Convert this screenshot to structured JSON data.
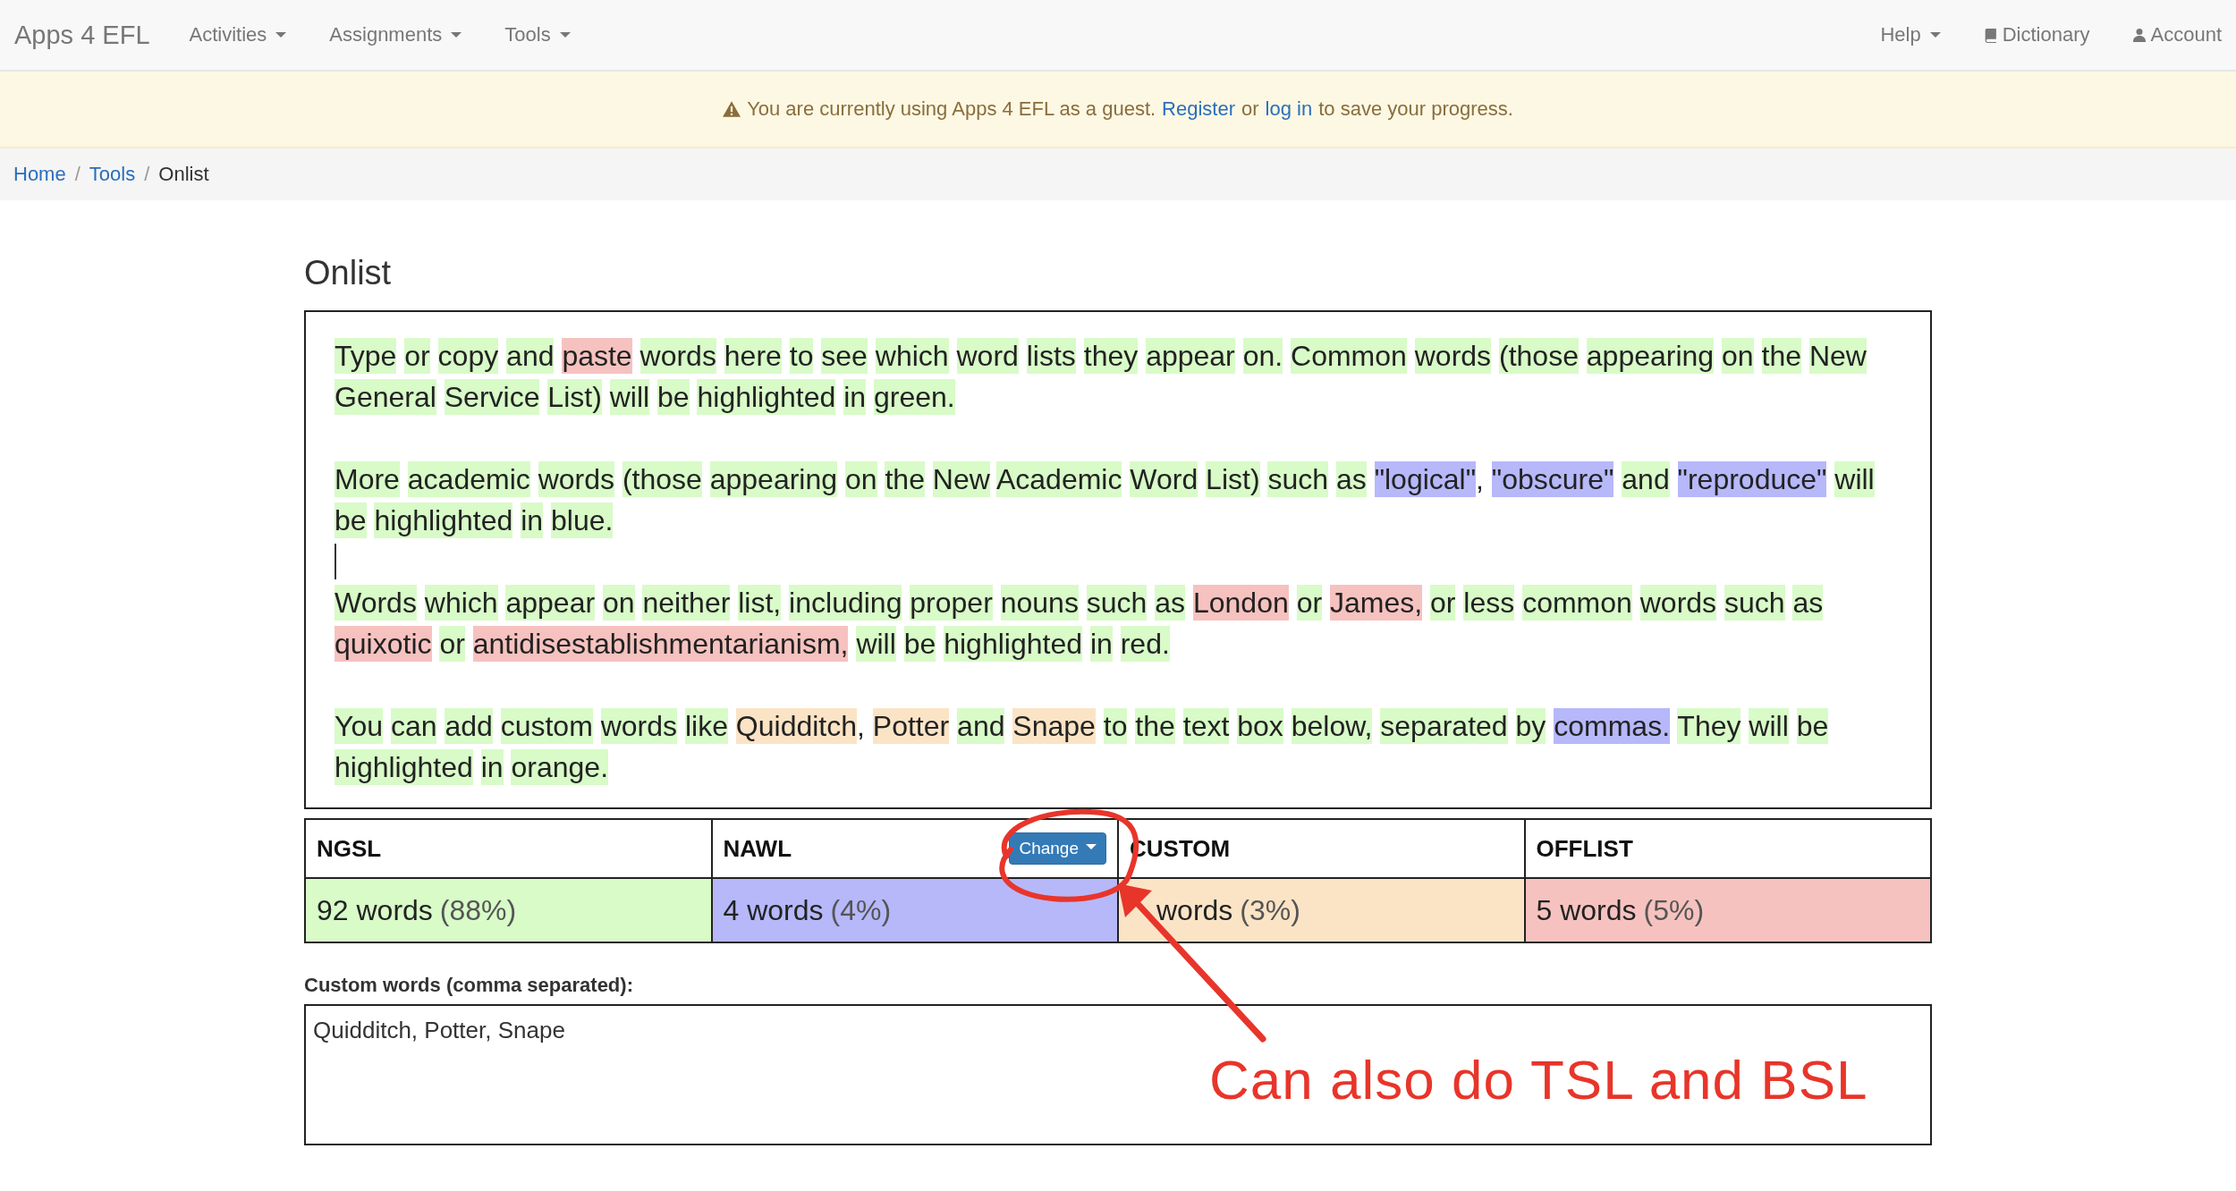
{
  "navbar": {
    "brand": "Apps 4 EFL",
    "left_menus": [
      {
        "label": "Activities"
      },
      {
        "label": "Assignments"
      },
      {
        "label": "Tools"
      }
    ],
    "right_items": [
      {
        "label": "Help",
        "kind": "dropdown"
      },
      {
        "label": "Dictionary",
        "kind": "book"
      },
      {
        "label": "Account",
        "kind": "user"
      }
    ]
  },
  "alert": {
    "before": "You are currently using Apps 4 EFL as a guest.",
    "link1": "Register",
    "middle": "or",
    "link2": "log in",
    "after": "to save your progress."
  },
  "breadcrumb": {
    "separator": "/",
    "items": [
      {
        "label": "Home",
        "selected": false
      },
      {
        "label": "Tools",
        "selected": false
      },
      {
        "label": "Onlist",
        "selected": true
      }
    ]
  },
  "title": "Onlist",
  "editor": {
    "paragraphs": [
      {
        "words": [
          {
            "w": "Type",
            "kind": "ngsl"
          },
          {
            "w": "or",
            "kind": "ngsl"
          },
          {
            "w": "copy",
            "kind": "ngsl"
          },
          {
            "w": "and",
            "kind": "ngsl"
          },
          {
            "w": "paste",
            "kind": "offlist"
          },
          {
            "w": "words",
            "kind": "ngsl"
          },
          {
            "w": "here",
            "kind": "ngsl"
          },
          {
            "w": "to",
            "kind": "ngsl"
          },
          {
            "w": "see",
            "kind": "ngsl"
          },
          {
            "w": "which",
            "kind": "ngsl"
          },
          {
            "w": "word",
            "kind": "ngsl"
          },
          {
            "w": "lists",
            "kind": "ngsl"
          },
          {
            "w": "they",
            "kind": "ngsl"
          },
          {
            "w": "appear",
            "kind": "ngsl"
          },
          {
            "w": "on.",
            "kind": "ngsl"
          },
          {
            "w": "Common",
            "kind": "ngsl"
          },
          {
            "w": "words",
            "kind": "ngsl"
          },
          {
            "w": "(those",
            "kind": "ngsl"
          },
          {
            "w": "appearing",
            "kind": "ngsl"
          },
          {
            "w": "on",
            "kind": "ngsl"
          },
          {
            "w": "the",
            "kind": "ngsl"
          },
          {
            "w": "New",
            "kind": "ngsl"
          },
          {
            "w": "General",
            "kind": "ngsl"
          },
          {
            "w": "Service",
            "kind": "ngsl"
          },
          {
            "w": "List)",
            "kind": "ngsl"
          },
          {
            "w": "will",
            "kind": "ngsl"
          },
          {
            "w": "be",
            "kind": "ngsl"
          },
          {
            "w": "highlighted",
            "kind": "ngsl"
          },
          {
            "w": "in",
            "kind": "ngsl"
          },
          {
            "w": "green.",
            "kind": "ngsl"
          }
        ]
      },
      {
        "words": [
          {
            "w": "More",
            "kind": "ngsl"
          },
          {
            "w": "academic",
            "kind": "ngsl"
          },
          {
            "w": "words",
            "kind": "ngsl"
          },
          {
            "w": "(those",
            "kind": "ngsl"
          },
          {
            "w": "appearing",
            "kind": "ngsl"
          },
          {
            "w": "on",
            "kind": "ngsl"
          },
          {
            "w": "the",
            "kind": "ngsl"
          },
          {
            "w": "New",
            "kind": "ngsl"
          },
          {
            "w": "Academic",
            "kind": "ngsl"
          },
          {
            "w": "Word",
            "kind": "ngsl"
          },
          {
            "w": "List)",
            "kind": "ngsl"
          },
          {
            "w": "such",
            "kind": "ngsl"
          },
          {
            "w": "as",
            "kind": "ngsl"
          },
          {
            "w": "\"logical\"",
            "kind": "nawl"
          },
          {
            "w": ",",
            "kind": "punct"
          },
          {
            "w": "\"obscure\"",
            "kind": "nawl"
          },
          {
            "w": "and",
            "kind": "ngsl"
          },
          {
            "w": "\"reproduce\"",
            "kind": "nawl"
          },
          {
            "w": "will",
            "kind": "ngsl"
          },
          {
            "w": "be",
            "kind": "ngsl"
          },
          {
            "w": "highlighted",
            "kind": "ngsl"
          },
          {
            "w": "in",
            "kind": "ngsl"
          },
          {
            "w": "blue.",
            "kind": "ngsl"
          }
        ],
        "caret_after": true
      },
      {
        "words": [
          {
            "w": "Words",
            "kind": "ngsl"
          },
          {
            "w": "which",
            "kind": "ngsl"
          },
          {
            "w": "appear",
            "kind": "ngsl"
          },
          {
            "w": "on",
            "kind": "ngsl"
          },
          {
            "w": "neither",
            "kind": "ngsl"
          },
          {
            "w": "list,",
            "kind": "ngsl"
          },
          {
            "w": "including",
            "kind": "ngsl"
          },
          {
            "w": "proper",
            "kind": "ngsl"
          },
          {
            "w": "nouns",
            "kind": "ngsl"
          },
          {
            "w": "such",
            "kind": "ngsl"
          },
          {
            "w": "as",
            "kind": "ngsl"
          },
          {
            "w": "London",
            "kind": "offlist"
          },
          {
            "w": "or",
            "kind": "ngsl"
          },
          {
            "w": "James,",
            "kind": "offlist"
          },
          {
            "w": "or",
            "kind": "ngsl"
          },
          {
            "w": "less",
            "kind": "ngsl"
          },
          {
            "w": "common",
            "kind": "ngsl"
          },
          {
            "w": "words",
            "kind": "ngsl"
          },
          {
            "w": "such",
            "kind": "ngsl"
          },
          {
            "w": "as",
            "kind": "ngsl"
          },
          {
            "w": "quixotic",
            "kind": "offlist"
          },
          {
            "w": "or",
            "kind": "ngsl"
          },
          {
            "w": "antidisestablishmentarianism,",
            "kind": "offlist"
          },
          {
            "w": "will",
            "kind": "ngsl"
          },
          {
            "w": "be",
            "kind": "ngsl"
          },
          {
            "w": "highlighted",
            "kind": "ngsl"
          },
          {
            "w": "in",
            "kind": "ngsl"
          },
          {
            "w": "red.",
            "kind": "ngsl"
          }
        ]
      },
      {
        "words": [
          {
            "w": "You",
            "kind": "ngsl"
          },
          {
            "w": "can",
            "kind": "ngsl"
          },
          {
            "w": "add",
            "kind": "ngsl"
          },
          {
            "w": "custom",
            "kind": "ngsl"
          },
          {
            "w": "words",
            "kind": "ngsl"
          },
          {
            "w": "like",
            "kind": "ngsl"
          },
          {
            "w": "Quidditch",
            "kind": "custom"
          },
          {
            "w": ",",
            "kind": "punct"
          },
          {
            "w": "Potter",
            "kind": "custom"
          },
          {
            "w": "and",
            "kind": "ngsl"
          },
          {
            "w": "Snape",
            "kind": "custom"
          },
          {
            "w": "to",
            "kind": "ngsl"
          },
          {
            "w": "the",
            "kind": "ngsl"
          },
          {
            "w": "text",
            "kind": "ngsl"
          },
          {
            "w": "box",
            "kind": "ngsl"
          },
          {
            "w": "below,",
            "kind": "ngsl"
          },
          {
            "w": "separated",
            "kind": "ngsl"
          },
          {
            "w": "by",
            "kind": "ngsl"
          },
          {
            "w": "commas.",
            "kind": "nawl"
          },
          {
            "w": "They",
            "kind": "ngsl"
          },
          {
            "w": "will",
            "kind": "ngsl"
          },
          {
            "w": "be",
            "kind": "ngsl"
          },
          {
            "w": "highlighted",
            "kind": "ngsl"
          },
          {
            "w": "in",
            "kind": "ngsl"
          },
          {
            "w": "orange.",
            "kind": "ngsl"
          }
        ]
      }
    ]
  },
  "stats": [
    {
      "heading": "NGSL",
      "kind": "ngsl",
      "count": "92 words",
      "percent": "(88%)"
    },
    {
      "heading": "NAWL",
      "kind": "nawl",
      "count": "4 words",
      "percent": "(4%)",
      "button": "Change"
    },
    {
      "heading": "CUSTOM",
      "kind": "custom",
      "count": "words",
      "percent": "(3%)"
    },
    {
      "heading": "OFFLIST",
      "kind": "offlist",
      "count": "5 words",
      "percent": "(5%)"
    }
  ],
  "custom_words": {
    "label": "Custom words (comma separated):",
    "value": "Quidditch, Potter, Snape"
  },
  "annotation": {
    "text": "Can also do TSL and BSL"
  }
}
